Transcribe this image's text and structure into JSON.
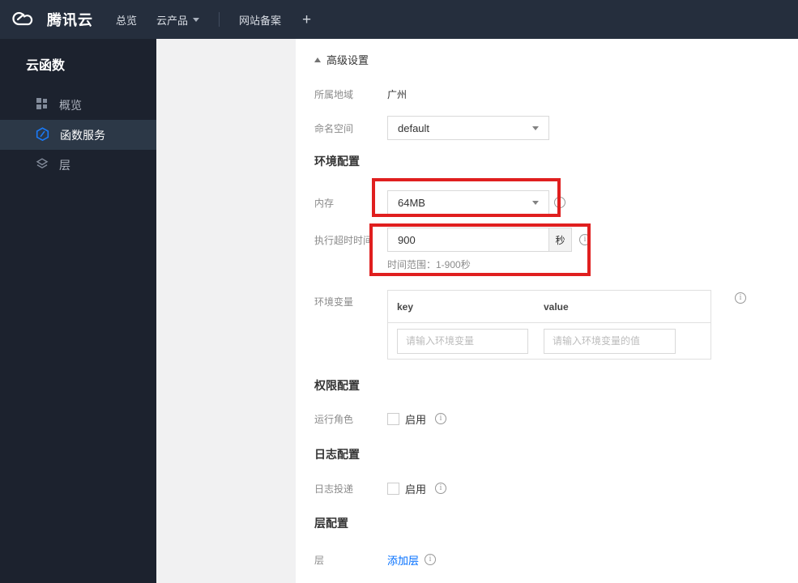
{
  "topbar": {
    "brand": "腾讯云",
    "nav": [
      {
        "label": "总览"
      },
      {
        "label": "云产品"
      },
      {
        "label": "网站备案"
      }
    ],
    "plus": "+"
  },
  "sidebar": {
    "title": "云函数",
    "items": [
      {
        "label": "概览",
        "icon": "grid-icon",
        "active": false
      },
      {
        "label": "函数服务",
        "icon": "function-hexagon-icon",
        "active": true
      },
      {
        "label": "层",
        "icon": "layers-icon",
        "active": false
      }
    ]
  },
  "main": {
    "advanced_toggle": "高级设置",
    "region_label": "所属地域",
    "region_value": "广州",
    "namespace_label": "命名空间",
    "namespace_value": "default",
    "section_env": "环境配置",
    "memory_label": "内存",
    "memory_value": "64MB",
    "timeout_label": "执行超时时间",
    "timeout_value": "900",
    "timeout_unit": "秒",
    "timeout_hint": "时间范围：1-900秒",
    "envvar_label": "环境变量",
    "envvar_col_key": "key",
    "envvar_col_value": "value",
    "envvar_key_placeholder": "请输入环境变量",
    "envvar_value_placeholder": "请输入环境变量的值",
    "section_permission": "权限配置",
    "role_label": "运行角色",
    "role_checkbox_label": "启用",
    "section_log": "日志配置",
    "log_label": "日志投递",
    "log_checkbox_label": "启用",
    "section_layer": "层配置",
    "layer_label": "层",
    "layer_add_link": "添加层"
  },
  "colors": {
    "topbar_bg": "#252e3d",
    "sidebar_bg": "#1c222e",
    "sidebar_active_bg": "#2c3847",
    "accent_blue": "#006eff",
    "annotation_red": "#e01f1f",
    "panel_gray": "#f1f1f2"
  }
}
